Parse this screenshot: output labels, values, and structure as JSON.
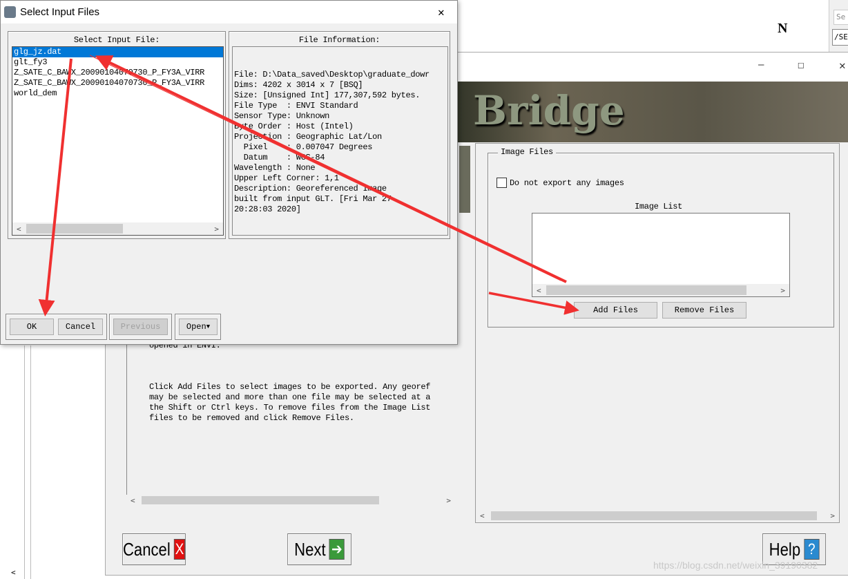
{
  "bg_window": {
    "north_symbol": "N",
    "search_placeholder": "Se",
    "path_field": "/SE"
  },
  "main_window": {
    "banner_title": "Bridge",
    "window_controls": {
      "minimize": "—",
      "maximize": "☐",
      "close": "✕"
    },
    "help_text_partial": "opened in ENVI.",
    "help_text": [
      "Click Add Files to select images to be exported. Any georef",
      "may be selected and more than one file may be selected at a",
      "the Shift or Ctrl keys. To remove files from the Image List",
      "files to be removed and click Remove Files."
    ],
    "image_files_group": "Image Files",
    "no_export_checkbox": {
      "label": "Do not export any images",
      "checked": false
    },
    "image_list_label": "Image List",
    "image_list_items": [],
    "add_files": "Add Files",
    "remove_files": "Remove Files",
    "cancel": "Cancel",
    "next": "Next",
    "help": "Help"
  },
  "dialog": {
    "title": "Select Input Files",
    "close": "✕",
    "select_label": "Select Input File:",
    "files": [
      "glg_jz.dat",
      "glt_fy3",
      "Z_SATE_C_BAWX_20090104070730_P_FY3A_VIRR",
      "Z_SATE_C_BAWX_20090104070730_P_FY3A_VIRR",
      "world_dem"
    ],
    "selected_index": 0,
    "info_label": "File Information:",
    "info_lines": [
      "File: D:\\Data_saved\\Desktop\\graduate_dowr",
      "Dims: 4202 x 3014 x 7 [BSQ]",
      "Size: [Unsigned Int] 177,307,592 bytes.",
      "File Type  : ENVI Standard",
      "Sensor Type: Unknown",
      "Byte Order : Host (Intel)",
      "Projection : Geographic Lat/Lon",
      "  Pixel    : 0.007047 Degrees",
      "  Datum    : WGS-84",
      "Wavelength : None",
      "Upper Left Corner: 1,1",
      "Description: Georeferenced Image",
      "built from input GLT. [Fri Mar 27",
      "20:28:03 2020]"
    ],
    "ok": "OK",
    "cancel": "Cancel",
    "previous": "Previous",
    "open": "Open"
  },
  "watermark": "https://blog.csdn.net/weixin_39190382",
  "colors": {
    "selection": "#0078d7",
    "arrow": "#f03030",
    "cancel_icon": "#e01010",
    "next_icon": "#3a9a3a",
    "help_icon": "#2a8ad0"
  }
}
